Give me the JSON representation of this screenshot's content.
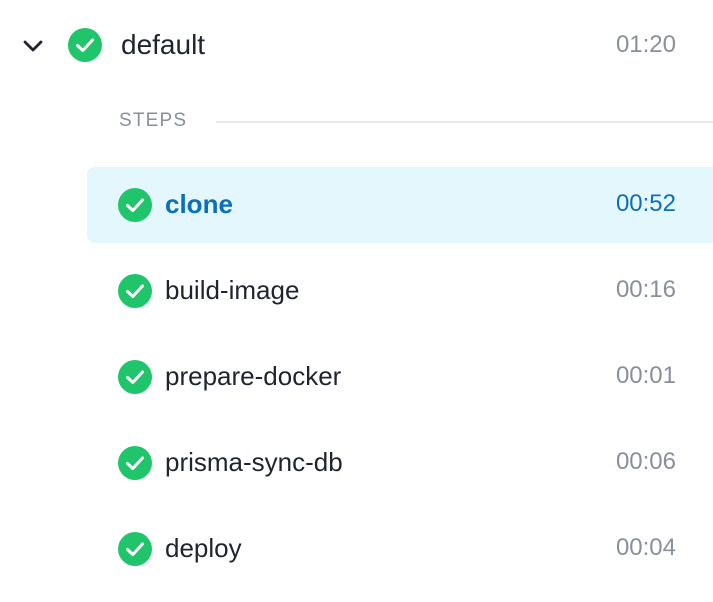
{
  "stage": {
    "name": "default",
    "duration": "01:20",
    "status": "success",
    "expanded": true
  },
  "steps_section": {
    "label": "STEPS"
  },
  "steps": [
    {
      "name": "clone",
      "duration": "00:52",
      "status": "success",
      "selected": true
    },
    {
      "name": "build-image",
      "duration": "00:16",
      "status": "success",
      "selected": false
    },
    {
      "name": "prepare-docker",
      "duration": "00:01",
      "status": "success",
      "selected": false
    },
    {
      "name": "prisma-sync-db",
      "duration": "00:06",
      "status": "success",
      "selected": false
    },
    {
      "name": "deploy",
      "duration": "00:04",
      "status": "success",
      "selected": false
    }
  ],
  "colors": {
    "success": "#20c56b",
    "selected_bg": "#e4f7fd",
    "selected_text": "#0b6fbd",
    "muted_text": "#8a8f9c",
    "primary_text": "#1f2430"
  },
  "icons": {
    "toggle": "chevron-down-icon",
    "status": "check-circle-icon"
  }
}
